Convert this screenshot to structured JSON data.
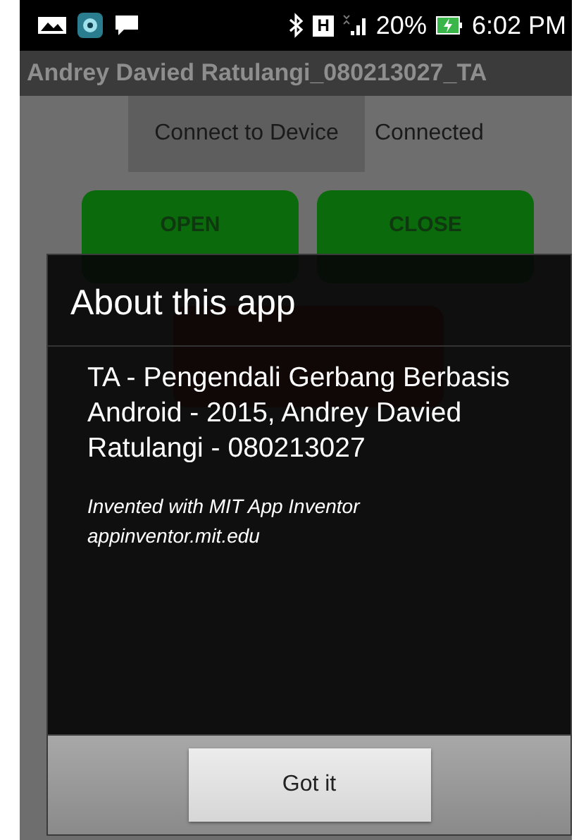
{
  "status_bar": {
    "network_type": "H",
    "battery": "20%",
    "time": "6:02 PM"
  },
  "title_bar": {
    "title": "Andrey Davied Ratulangi_080213027_TA"
  },
  "connect_button": {
    "label": "Connect to Device"
  },
  "connection_status": "Connected",
  "gate_buttons": [
    {
      "label": "OPEN"
    },
    {
      "label": "CLOSE"
    }
  ],
  "dialog": {
    "title": "About this app",
    "message": "TA - Pengendali Gerbang Berbasis Android - 2015, Andrey Davied Ratulangi - 080213027",
    "credit_lines": [
      "Invented with MIT App Inventor",
      "appinventor.mit.edu"
    ],
    "buttons": [
      "Got it"
    ]
  }
}
